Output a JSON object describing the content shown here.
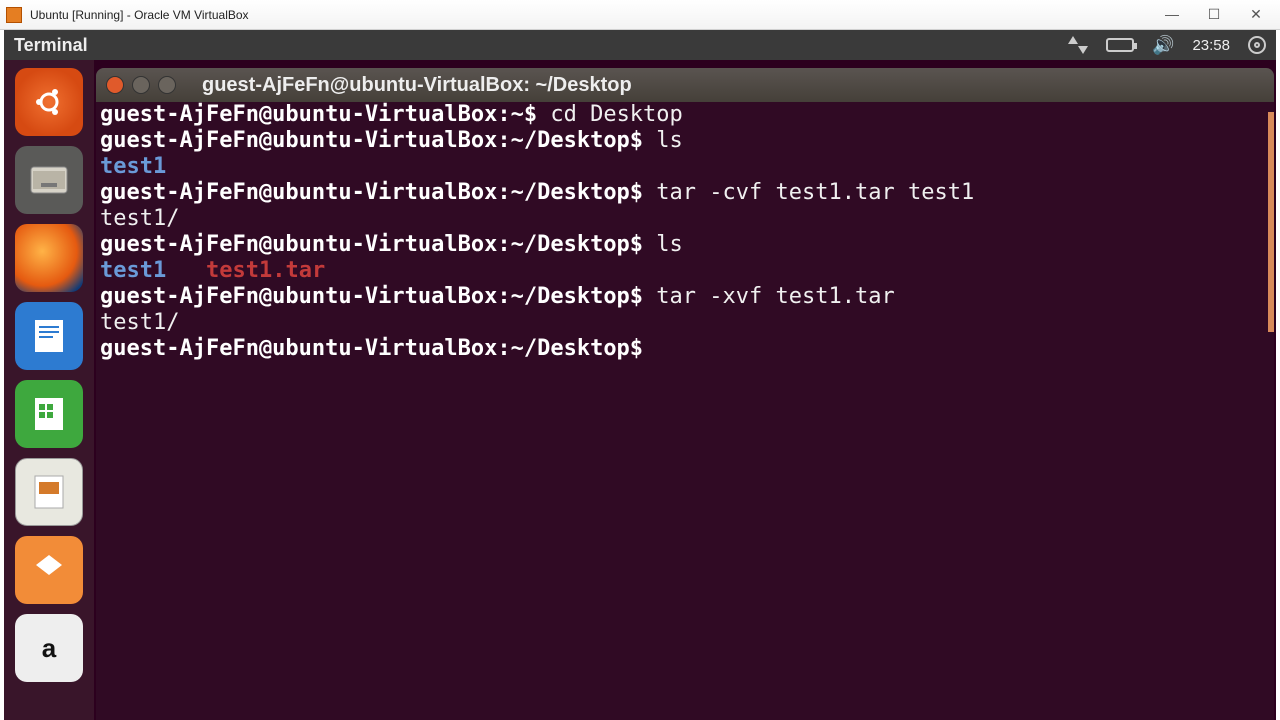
{
  "vbox": {
    "title": "Ubuntu [Running] - Oracle VM VirtualBox",
    "minimize": "—",
    "maximize": "☐",
    "close": "✕"
  },
  "menubar": {
    "app": "Terminal",
    "time": "23:58"
  },
  "launcher": {
    "items": [
      {
        "name": "dash",
        "label": ""
      },
      {
        "name": "files",
        "label": ""
      },
      {
        "name": "firefox",
        "label": ""
      },
      {
        "name": "writer",
        "label": ""
      },
      {
        "name": "calc",
        "label": ""
      },
      {
        "name": "impress",
        "label": ""
      },
      {
        "name": "software",
        "label": ""
      },
      {
        "name": "amazon",
        "label": ""
      }
    ]
  },
  "terminal": {
    "title": "guest-AjFeFn@ubuntu-VirtualBox: ~/Desktop",
    "prompt_home": "guest-AjFeFn@ubuntu-VirtualBox:~$",
    "prompt_desktop": "guest-AjFeFn@ubuntu-VirtualBox:~/Desktop$",
    "lines": {
      "cmd1": " cd Desktop",
      "cmd2": " ls",
      "out2": "test1",
      "cmd3": " tar -cvf test1.tar test1",
      "out3": "test1/",
      "cmd4": " ls",
      "out4a": "test1",
      "out4gap": "   ",
      "out4b": "test1.tar",
      "cmd5": " tar -xvf test1.tar",
      "out5": "test1/",
      "cmd6": " "
    }
  }
}
